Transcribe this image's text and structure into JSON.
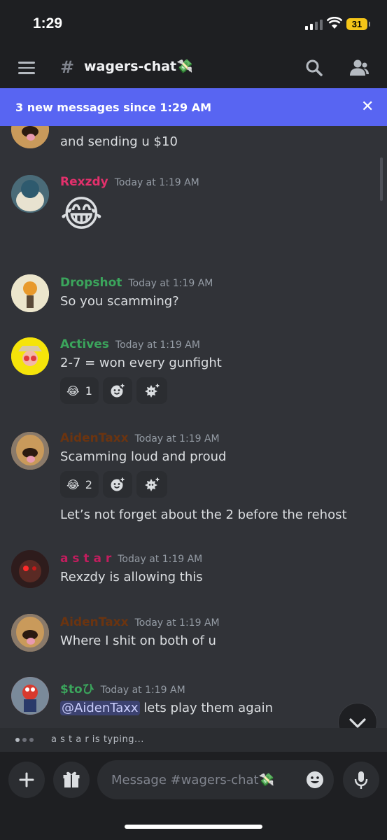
{
  "status_bar": {
    "time": "1:29",
    "battery": "31"
  },
  "header": {
    "channel_name": "wagers-chat💸"
  },
  "banner": {
    "text": "3 new messages since 1:29 AM"
  },
  "colors": {
    "accent": "#5865f2",
    "background": "#313338",
    "header": "#1e1f22"
  },
  "messages": [
    {
      "author": "",
      "timestamp": "",
      "text": "and sending u $10"
    },
    {
      "author": "Rexzdy",
      "author_color": "#e3306c",
      "timestamp": "Today at 1:19 AM",
      "text": "😂"
    },
    {
      "author": "Dropshot",
      "author_color": "#3ba55c",
      "timestamp": "Today at 1:19 AM",
      "text": "So you scamming?"
    },
    {
      "author": "Actives",
      "author_color": "#3ba55c",
      "timestamp": "Today at 1:19 AM",
      "text": "2-7 = won every gunfight",
      "reactions": [
        {
          "emoji": "😂",
          "count": "1"
        }
      ]
    },
    {
      "author": "AidenTaxx",
      "author_color": "#6b3410",
      "timestamp": "Today at 1:19 AM",
      "text": "Scamming loud and proud",
      "reactions": [
        {
          "emoji": "😂",
          "count": "2"
        }
      ],
      "followup": "Let’s not forget about the 2 before the rehost"
    },
    {
      "author": "a s t a r",
      "author_color": "#c21d5e",
      "timestamp": "Today at 1:19 AM",
      "text": "Rexzdy is allowing this"
    },
    {
      "author": "AidenTaxx",
      "author_color": "#6b3410",
      "timestamp": "Today at 1:19 AM",
      "text": "Where I shit on both of u"
    },
    {
      "author": "$toひ",
      "author_color": "#3ba55c",
      "timestamp": "Today at 1:19 AM",
      "mention": "@AidenTaxx",
      "text": " lets play them again"
    }
  ],
  "typing": {
    "text": "a s t a r is typing..."
  },
  "composer": {
    "placeholder": "Message #wagers-chat💸"
  }
}
